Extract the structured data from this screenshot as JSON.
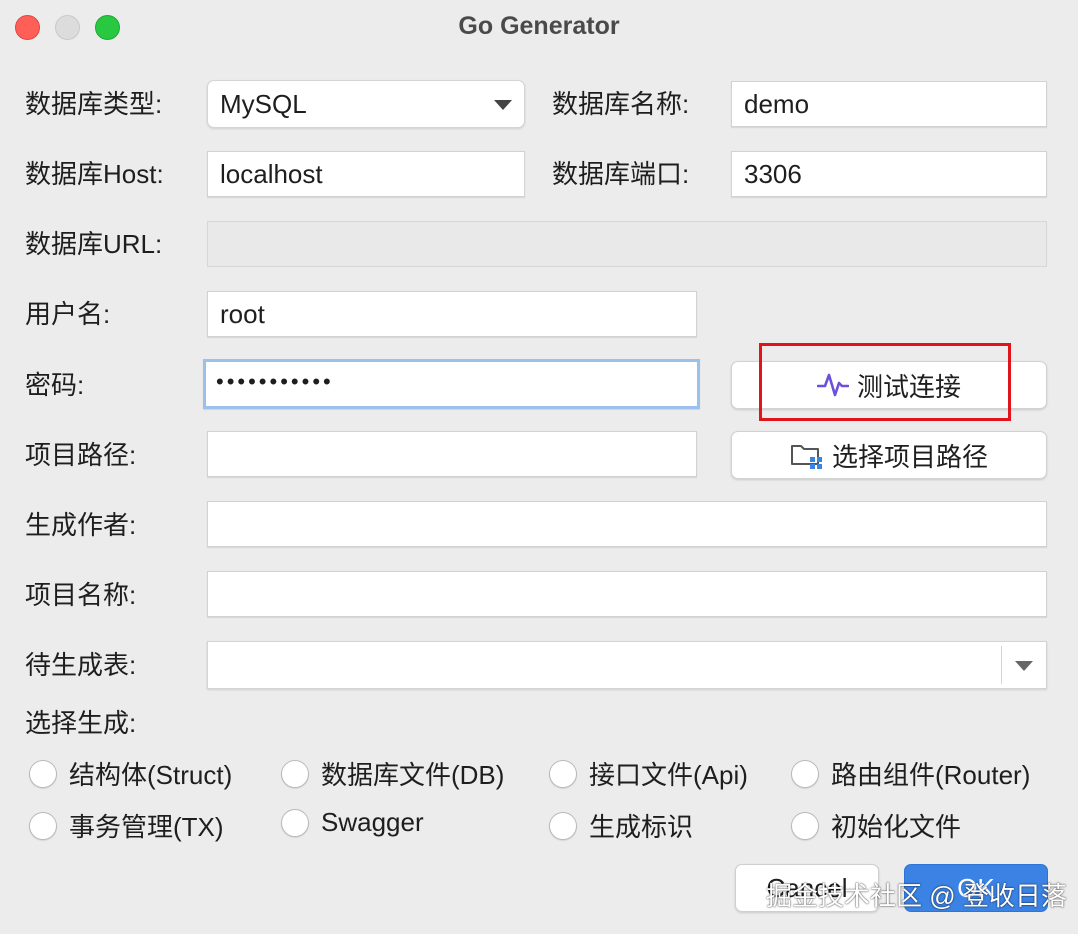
{
  "window": {
    "title": "Go Generator"
  },
  "form": {
    "db_type_label": "数据库类型:",
    "db_type_value": "MySQL",
    "db_name_label": "数据库名称:",
    "db_name_value": "demo",
    "db_host_label": "数据库Host:",
    "db_host_value": "localhost",
    "db_port_label": "数据库端口:",
    "db_port_value": "3306",
    "db_url_label": "数据库URL:",
    "db_url_value": "",
    "username_label": "用户名:",
    "username_value": "root",
    "password_label": "密码:",
    "password_value": "•••••••••••",
    "test_connection_label": "测试连接",
    "project_path_label": "项目路径:",
    "project_path_value": "",
    "choose_path_label": "选择项目路径",
    "author_label": "生成作者:",
    "author_value": "",
    "project_name_label": "项目名称:",
    "project_name_value": "",
    "tables_label": "待生成表:",
    "tables_value": "",
    "generate_label": "选择生成:"
  },
  "options": [
    {
      "label": "结构体(Struct)",
      "checked": false
    },
    {
      "label": "数据库文件(DB)",
      "checked": false
    },
    {
      "label": "接口文件(Api)",
      "checked": false
    },
    {
      "label": "路由组件(Router)",
      "checked": false
    },
    {
      "label": "事务管理(TX)",
      "checked": false
    },
    {
      "label": "Swagger",
      "checked": false
    },
    {
      "label": "生成标识",
      "checked": false
    },
    {
      "label": "初始化文件",
      "checked": false
    }
  ],
  "footer": {
    "cancel_label": "Cancel",
    "ok_label": "OK"
  },
  "watermark": "掘金技术社区 @ 登收日落",
  "colors": {
    "accent": "#3a82e4",
    "highlight_box": "#e0141b",
    "test_icon": "#6b4fe0"
  }
}
